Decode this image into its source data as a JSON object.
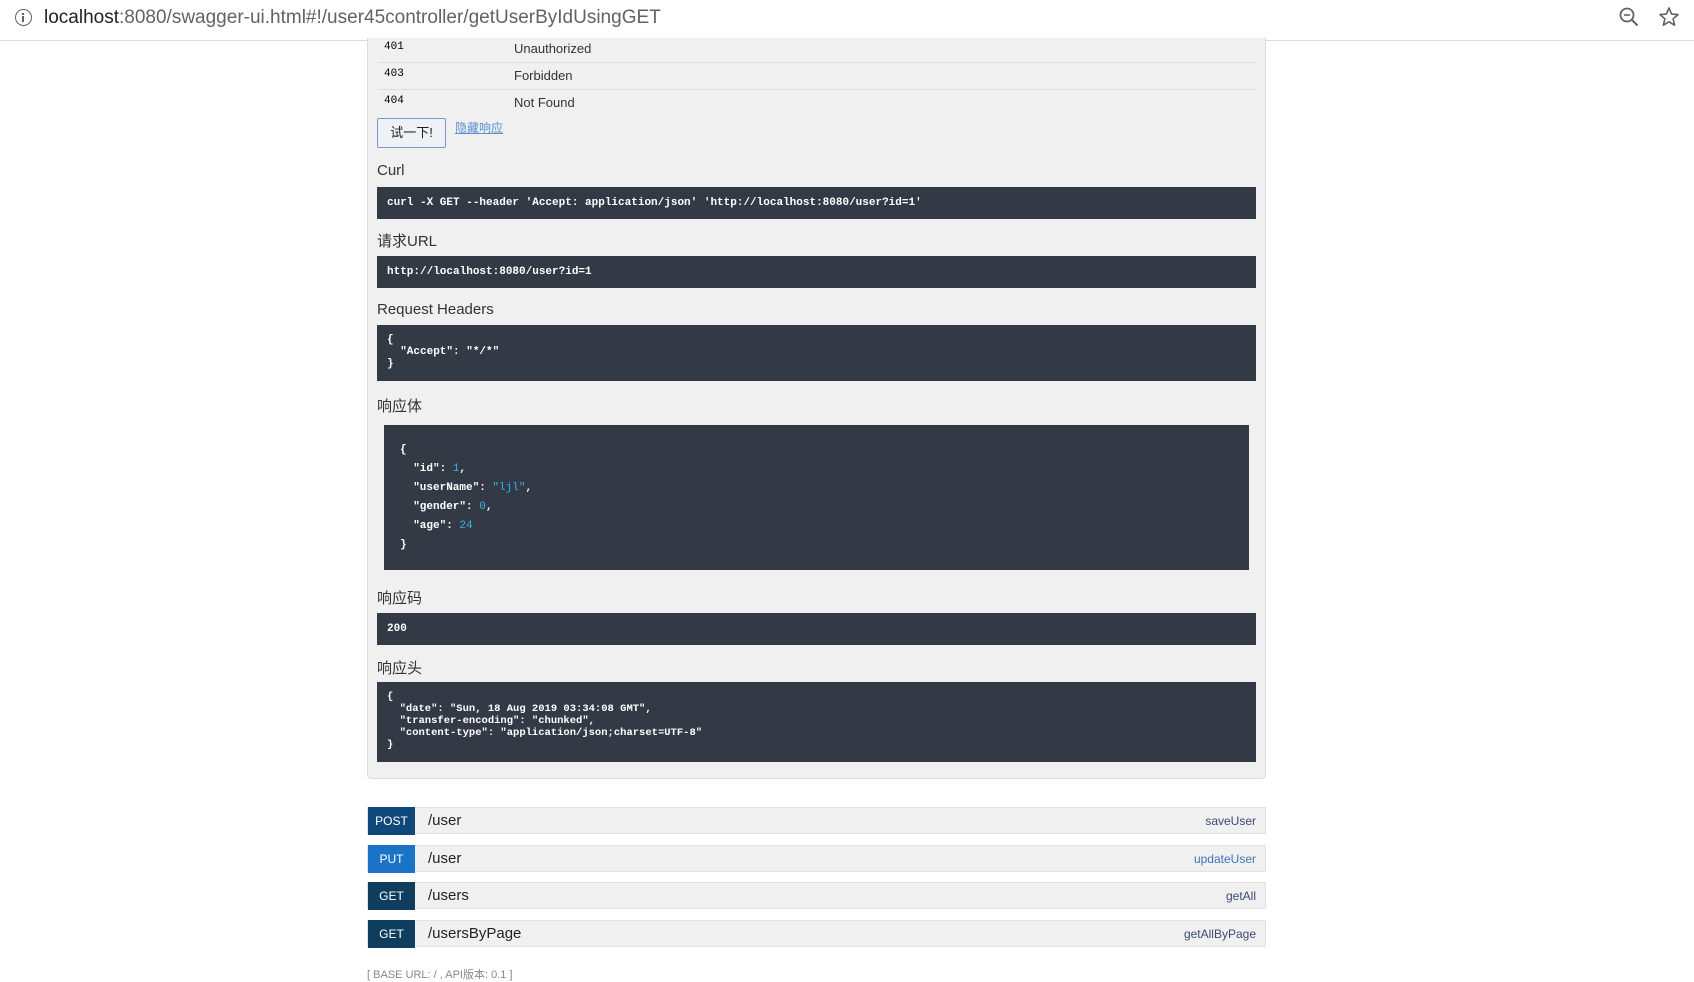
{
  "browser": {
    "url_host": "localhost",
    "url_rest": ":8080/swagger-ui.html#!/user45controller/getUserByIdUsingGET"
  },
  "responses": [
    {
      "code": "401",
      "message": "Unauthorized"
    },
    {
      "code": "403",
      "message": "Forbidden"
    },
    {
      "code": "404",
      "message": "Not Found"
    }
  ],
  "actions": {
    "try_label": "试一下!",
    "hide_label": "隐藏响应"
  },
  "curl": {
    "label": "Curl",
    "command": "curl -X GET --header 'Accept: application/json' 'http://localhost:8080/user?id=1'"
  },
  "request_url": {
    "label": "请求URL",
    "value": "http://localhost:8080/user?id=1"
  },
  "request_headers": {
    "label": "Request Headers",
    "open": "{",
    "line": "  \"Accept\": \"*/*\"",
    "close": "}"
  },
  "response_body": {
    "label": "响应体",
    "open": "{",
    "id_key": "  \"id\": ",
    "id_val": "1",
    "username_key": "  \"userName\": ",
    "username_val": "\"ljl\"",
    "gender_key": "  \"gender\": ",
    "gender_val": "0",
    "age_key": "  \"age\": ",
    "age_val": "24",
    "comma": ",",
    "close": "}"
  },
  "response_code": {
    "label": "响应码",
    "value": "200"
  },
  "response_headers": {
    "label": "响应头",
    "open": "{",
    "line1": "  \"date\": \"Sun, 18 Aug 2019 03:34:08 GMT\",",
    "line2": "  \"transfer-encoding\": \"chunked\",",
    "line3": "  \"content-type\": \"application/json;charset=UTF-8\"",
    "close": "}"
  },
  "operations": [
    {
      "method": "POST",
      "path": "/user",
      "name": "saveUser",
      "color": "#10487c"
    },
    {
      "method": "PUT",
      "path": "/user",
      "name": "updateUser",
      "color": "#1a73c6"
    },
    {
      "method": "GET",
      "path": "/users",
      "name": "getAll",
      "color": "#0f3d5e"
    },
    {
      "method": "GET",
      "path": "/usersByPage",
      "name": "getAllByPage",
      "color": "#0f3d5e"
    }
  ],
  "footer": "[ BASE URL: / , API版本: 0.1 ]",
  "colors": {
    "code_bg": "#333a45",
    "panel_bg": "#f0f0f0",
    "link": "#5b8fd0",
    "json_value": "#33b5e5"
  }
}
